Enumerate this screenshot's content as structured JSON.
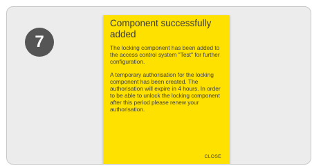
{
  "step": {
    "number": "7"
  },
  "dialog": {
    "title": "Component successfully added",
    "paragraphs": [
      "The locking component has been added to the access control system \"Test\" for further configuration.",
      "A temporary authorisation for the locking component has been created. The authorisation will expire in 4 hours. In order to be able to unlock the locking component after this period please renew your authorisation."
    ],
    "close_label": "CLOSE"
  },
  "colors": {
    "dialog_background": "#ffe100",
    "badge_background": "#555555",
    "frame_background": "#ececec"
  }
}
